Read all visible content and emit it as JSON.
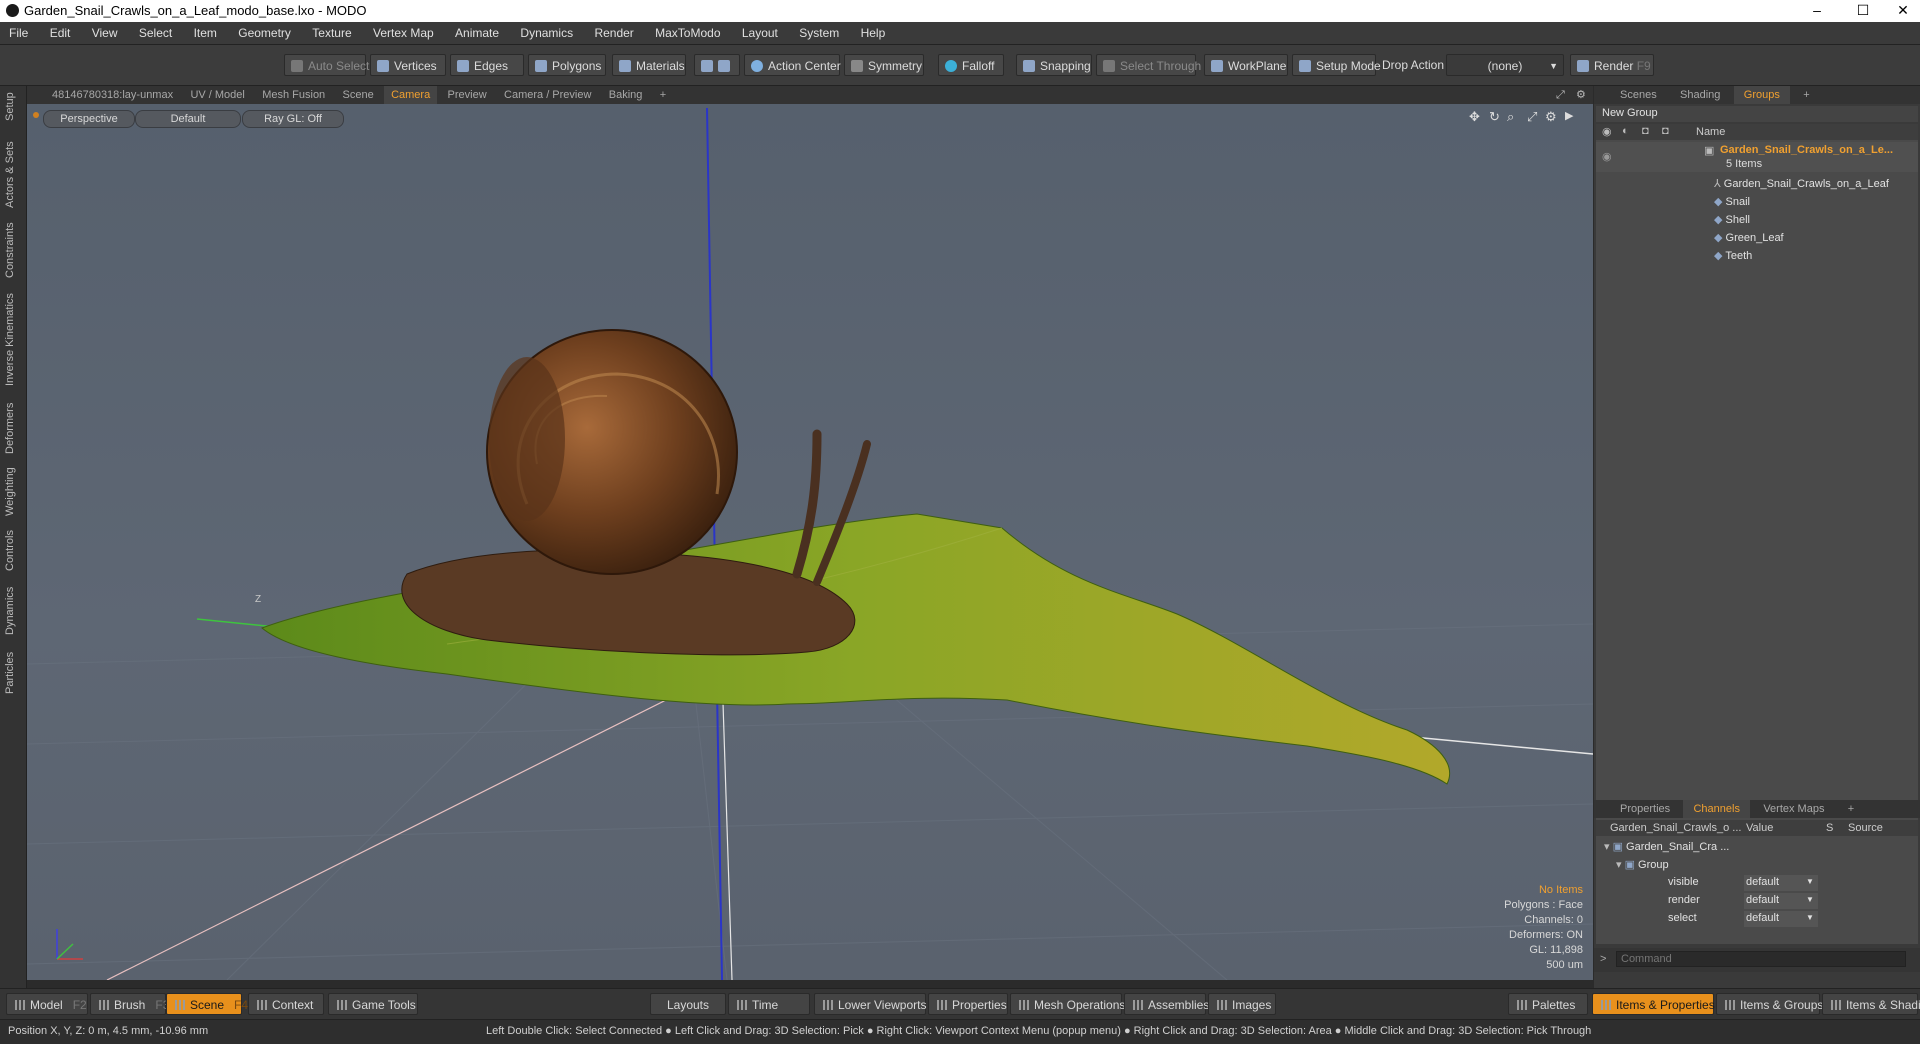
{
  "window": {
    "title": "Garden_Snail_Crawls_on_a_Leaf_modo_base.lxo - MODO",
    "minimize": "–",
    "maximize": "☐",
    "close": "✕"
  },
  "menu": [
    "File",
    "Edit",
    "View",
    "Select",
    "Item",
    "Geometry",
    "Texture",
    "Vertex Map",
    "Animate",
    "Dynamics",
    "Render",
    "MaxToModo",
    "Layout",
    "System",
    "Help"
  ],
  "toolbar": {
    "auto_select": "Auto Select",
    "vertices": "Vertices",
    "edges": "Edges",
    "polygons": "Polygons",
    "materials": "Materials",
    "action_center": "Action Center",
    "symmetry": "Symmetry",
    "falloff": "Falloff",
    "snapping": "Snapping",
    "select_through": "Select Through",
    "workplane": "WorkPlane",
    "setup_mode": "Setup Mode",
    "drop_action": "Drop Action",
    "drop_value": "(none)",
    "render": "Render",
    "render_key": "F9"
  },
  "left_tabs": [
    "Setup",
    "Actors & Sets",
    "Constraints",
    "Inverse Kinematics",
    "Deformers",
    "Weighting",
    "Controls",
    "Dynamics",
    "Particles"
  ],
  "viewport_tabs": [
    "48146780318:lay-unmax",
    "UV / Model",
    "Mesh Fusion",
    "Scene",
    "Camera",
    "Preview",
    "Camera / Preview",
    "Baking",
    "+"
  ],
  "viewport_active_tab": "Camera",
  "viewport": {
    "projection": "Perspective",
    "shading": "Default",
    "raygl": "Ray GL: Off",
    "axis_label": "Z",
    "stats": {
      "items": "No Items",
      "polygons": "Polygons : Face",
      "channels": "Channels: 0",
      "deformers": "Deformers: ON",
      "gl": "GL: 11,898",
      "scale": "500 um"
    }
  },
  "scene_tabs": [
    "Scenes",
    "Shading",
    "Groups",
    "+"
  ],
  "scene_active_tab": "Groups",
  "groups": {
    "new_group": "New Group",
    "col_name": "Name",
    "root": "Garden_Snail_Crawls_on_a_Le...",
    "root_count": "5 Items",
    "items": [
      "Garden_Snail_Crawls_on_a_Leaf",
      "Snail",
      "Shell",
      "Green_Leaf",
      "Teeth"
    ]
  },
  "props_tabs": [
    "Properties",
    "Channels",
    "Vertex Maps",
    "+"
  ],
  "props_active_tab": "Channels",
  "channels": {
    "col_item": "Garden_Snail_Crawls_o ...",
    "col_value": "Value",
    "col_s": "S",
    "col_source": "Source",
    "item": "Garden_Snail_Cra ...",
    "group": "Group",
    "rows": [
      {
        "name": "visible",
        "value": "default"
      },
      {
        "name": "render",
        "value": "default"
      },
      {
        "name": "select",
        "value": "default"
      }
    ]
  },
  "command_placeholder": "Command",
  "bottom": {
    "model": "Model",
    "model_key": "F2",
    "brush": "Brush",
    "brush_key": "F3",
    "scene": "Scene",
    "scene_key": "F4",
    "context": "Context",
    "game_tools": "Game Tools",
    "layouts": "Layouts",
    "time": "Time",
    "lower_viewports": "Lower Viewports",
    "properties": "Properties",
    "mesh_operations": "Mesh Operations",
    "assemblies": "Assemblies",
    "images": "Images",
    "palettes": "Palettes",
    "items_properties": "Items & Properties",
    "items_groups": "Items & Groups",
    "items_shading": "Items & Shading"
  },
  "status": {
    "position": "Position X, Y, Z:  0 m, 4.5 mm, -10.96 mm",
    "hints": "Left Double Click: Select Connected ● Left Click and Drag: 3D Selection: Pick ● Right Click: Viewport Context Menu (popup menu) ● Right Click and Drag: 3D Selection: Area ● Middle Click and Drag: 3D Selection: Pick Through"
  },
  "colors": {
    "accent": "#e8901c",
    "active_tab": "#f0a030",
    "viewport_bg": "#5b6470"
  },
  "icons": [
    "app-icon",
    "eye-icon",
    "lock-icon",
    "mesh-icon",
    "group-icon",
    "gear-icon",
    "maximize-icon",
    "move-icon",
    "rotate-icon",
    "zoom-icon",
    "chevron-down-icon"
  ]
}
